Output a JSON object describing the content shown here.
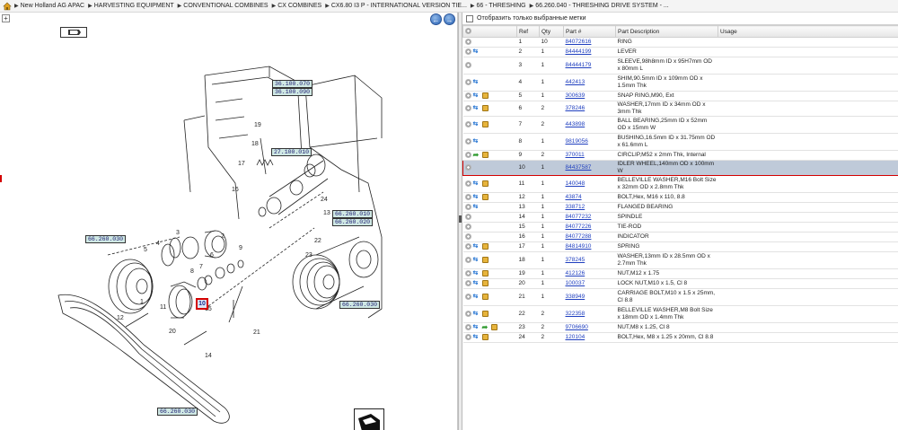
{
  "breadcrumb": {
    "items": [
      "New Holland AG APAC",
      "HARVESTING EQUIPMENT",
      "CONVENTIONAL COMBINES",
      "CX COMBINES",
      "CX6.80 I3 P - INTERNATIONAL VERSION TIE...",
      "66 - THRESHING",
      "66.260.040 - THRESHING DRIVE SYSTEM - ..."
    ]
  },
  "diagram": {
    "ref_tags": [
      "36.100.070",
      "36.100.090",
      "66.260.010",
      "66.260.020",
      "66.260.030",
      "66.260.030",
      "66.260.030",
      "27.100.010"
    ],
    "highlight_callout": "10",
    "callouts": [
      "1",
      "2",
      "3",
      "4",
      "5",
      "6",
      "7",
      "8",
      "9",
      "11",
      "12",
      "13",
      "14",
      "15",
      "16",
      "17",
      "18",
      "19",
      "20",
      "21",
      "22",
      "23",
      "24"
    ]
  },
  "filter": {
    "label": "Отобразить только выбранные метки"
  },
  "table": {
    "headers": {
      "ref": "Ref",
      "qty": "Qty",
      "part": "Part #",
      "desc": "Part Description",
      "usage": "Usage"
    },
    "rows": [
      {
        "ref": "1",
        "qty": "10",
        "part": "84072616",
        "desc": "RING",
        "icons": []
      },
      {
        "ref": "2",
        "qty": "1",
        "part": "84444199",
        "desc": "LEVER",
        "icons": [
          "link"
        ]
      },
      {
        "ref": "3",
        "qty": "1",
        "part": "84444179",
        "desc": "SLEEVE,98h8mm ID x  95H7mm OD x 80mm L",
        "icons": []
      },
      {
        "ref": "4",
        "qty": "1",
        "part": "442413",
        "desc": "SHIM,90.5mm ID x 109mm OD x 1.5mm Thk",
        "icons": [
          "link"
        ]
      },
      {
        "ref": "5",
        "qty": "1",
        "part": "300639",
        "desc": "SNAP RING,M90, Ext",
        "icons": [
          "link",
          "box"
        ]
      },
      {
        "ref": "6",
        "qty": "2",
        "part": "378246",
        "desc": "WASHER,17mm ID x 34mm OD x 3mm Thk",
        "icons": [
          "link",
          "box"
        ]
      },
      {
        "ref": "7",
        "qty": "2",
        "part": "443898",
        "desc": "BALL BEARING,25mm ID x 52mm OD x 15mm W",
        "icons": [
          "link",
          "box"
        ]
      },
      {
        "ref": "8",
        "qty": "1",
        "part": "9819056",
        "desc": "BUSHING,16.5mm ID x 31.75mm OD x 61.6mm L",
        "icons": [
          "link"
        ]
      },
      {
        "ref": "9",
        "qty": "2",
        "part": "370011",
        "desc": "CIRCLIP,M52 x 2mm Thk, Internal",
        "icons": [
          "arrow",
          "box"
        ]
      },
      {
        "ref": "10",
        "qty": "1",
        "part": "84437587",
        "desc": "IDLER WHEEL,140mm OD x 100mm W",
        "icons": [],
        "selected": true
      },
      {
        "ref": "11",
        "qty": "1",
        "part": "140048",
        "desc": "BELLEVILLE WASHER,M16 Bolt Size x 32mm OD x 2.8mm Thk",
        "icons": [
          "link",
          "box"
        ]
      },
      {
        "ref": "12",
        "qty": "1",
        "part": "43874",
        "desc": "BOLT,Hex, M16 x 110, 8.8",
        "icons": [
          "link",
          "box"
        ]
      },
      {
        "ref": "13",
        "qty": "1",
        "part": "338712",
        "desc": "FLANGED BEARING",
        "icons": [
          "link"
        ]
      },
      {
        "ref": "14",
        "qty": "1",
        "part": "84077232",
        "desc": "SPINDLE",
        "icons": []
      },
      {
        "ref": "15",
        "qty": "1",
        "part": "84077226",
        "desc": "TIE-ROD",
        "icons": []
      },
      {
        "ref": "16",
        "qty": "1",
        "part": "84077288",
        "desc": "INDICATOR",
        "icons": []
      },
      {
        "ref": "17",
        "qty": "1",
        "part": "84814910",
        "desc": "SPRING",
        "icons": [
          "link",
          "box"
        ]
      },
      {
        "ref": "18",
        "qty": "1",
        "part": "378245",
        "desc": "WASHER,13mm ID x 28.5mm OD x 2.7mm Thk",
        "icons": [
          "link",
          "box"
        ]
      },
      {
        "ref": "19",
        "qty": "1",
        "part": "412126",
        "desc": "NUT,M12 x 1.75",
        "icons": [
          "link",
          "box"
        ]
      },
      {
        "ref": "20",
        "qty": "1",
        "part": "100037",
        "desc": "LOCK NUT,M10 x 1.5, Cl 8",
        "icons": [
          "link",
          "box"
        ]
      },
      {
        "ref": "21",
        "qty": "1",
        "part": "338949",
        "desc": "CARRIAGE BOLT,M10 x 1.5 x 25mm, Cl 8.8",
        "icons": [
          "link",
          "box"
        ]
      },
      {
        "ref": "22",
        "qty": "2",
        "part": "322358",
        "desc": "BELLEVILLE WASHER,M8 Bolt Size x 18mm OD x 1.4mm Thk",
        "icons": [
          "link",
          "box"
        ]
      },
      {
        "ref": "23",
        "qty": "2",
        "part": "9706690",
        "desc": "NUT,M8 x 1.25, Cl 8",
        "icons": [
          "link",
          "arrow",
          "box"
        ]
      },
      {
        "ref": "24",
        "qty": "2",
        "part": "120104",
        "desc": "BOLT,Hex, M8 x 1.25 x 20mm, Cl 8.8",
        "icons": [
          "link",
          "box"
        ]
      }
    ]
  },
  "colors": {
    "link": "#1f3fbf",
    "selected_row": "#bfcad9",
    "highlight_border": "#d40000",
    "ref_tag_bg": "#cfe8e4"
  }
}
